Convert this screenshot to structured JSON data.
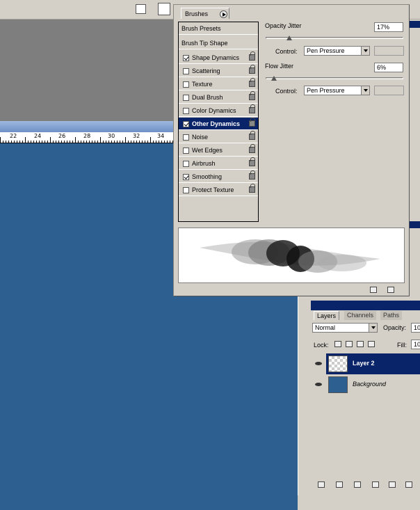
{
  "brushes": {
    "tab_label": "Brushes",
    "list": [
      {
        "label": "Brush Presets",
        "checkbox": false,
        "checked": false,
        "lock": false,
        "selected": false
      },
      {
        "label": "Brush Tip Shape",
        "checkbox": false,
        "checked": false,
        "lock": false,
        "selected": false
      },
      {
        "label": "Shape Dynamics",
        "checkbox": true,
        "checked": true,
        "lock": true,
        "selected": false
      },
      {
        "label": "Scattering",
        "checkbox": true,
        "checked": false,
        "lock": true,
        "selected": false
      },
      {
        "label": "Texture",
        "checkbox": true,
        "checked": false,
        "lock": true,
        "selected": false
      },
      {
        "label": "Dual Brush",
        "checkbox": true,
        "checked": false,
        "lock": true,
        "selected": false
      },
      {
        "label": "Color Dynamics",
        "checkbox": true,
        "checked": false,
        "lock": true,
        "selected": false
      },
      {
        "label": "Other Dynamics",
        "checkbox": true,
        "checked": true,
        "lock": true,
        "selected": true
      },
      {
        "label": "Noise",
        "checkbox": true,
        "checked": false,
        "lock": true,
        "selected": false
      },
      {
        "label": "Wet Edges",
        "checkbox": true,
        "checked": false,
        "lock": true,
        "selected": false
      },
      {
        "label": "Airbrush",
        "checkbox": true,
        "checked": false,
        "lock": true,
        "selected": false
      },
      {
        "label": "Smoothing",
        "checkbox": true,
        "checked": true,
        "lock": true,
        "selected": false
      },
      {
        "label": "Protect Texture",
        "checkbox": true,
        "checked": false,
        "lock": true,
        "selected": false
      }
    ],
    "opacity_jitter": {
      "label": "Opacity Jitter",
      "value": "17%",
      "fraction": 0.17,
      "control_label": "Control:",
      "control_value": "Pen Pressure"
    },
    "flow_jitter": {
      "label": "Flow Jitter",
      "value": "6%",
      "fraction": 0.06,
      "control_label": "Control:",
      "control_value": "Pen Pressure"
    }
  },
  "ruler": {
    "labels": [
      "22",
      "24",
      "26",
      "28",
      "30",
      "32",
      "34"
    ]
  },
  "layers": {
    "tabs": [
      "Layers",
      "Channels",
      "Paths"
    ],
    "blend_mode": "Normal",
    "opacity_label": "Opacity:",
    "opacity_value": "10",
    "lock_label": "Lock:",
    "fill_label": "Fill:",
    "fill_value": "10",
    "items": [
      {
        "name": "Layer 2",
        "selected": true
      },
      {
        "name": "Background",
        "selected": false
      }
    ]
  },
  "colors": {
    "canvas": "#2e5f91",
    "selection": "#0a246a",
    "panel": "#d4d0c8"
  }
}
